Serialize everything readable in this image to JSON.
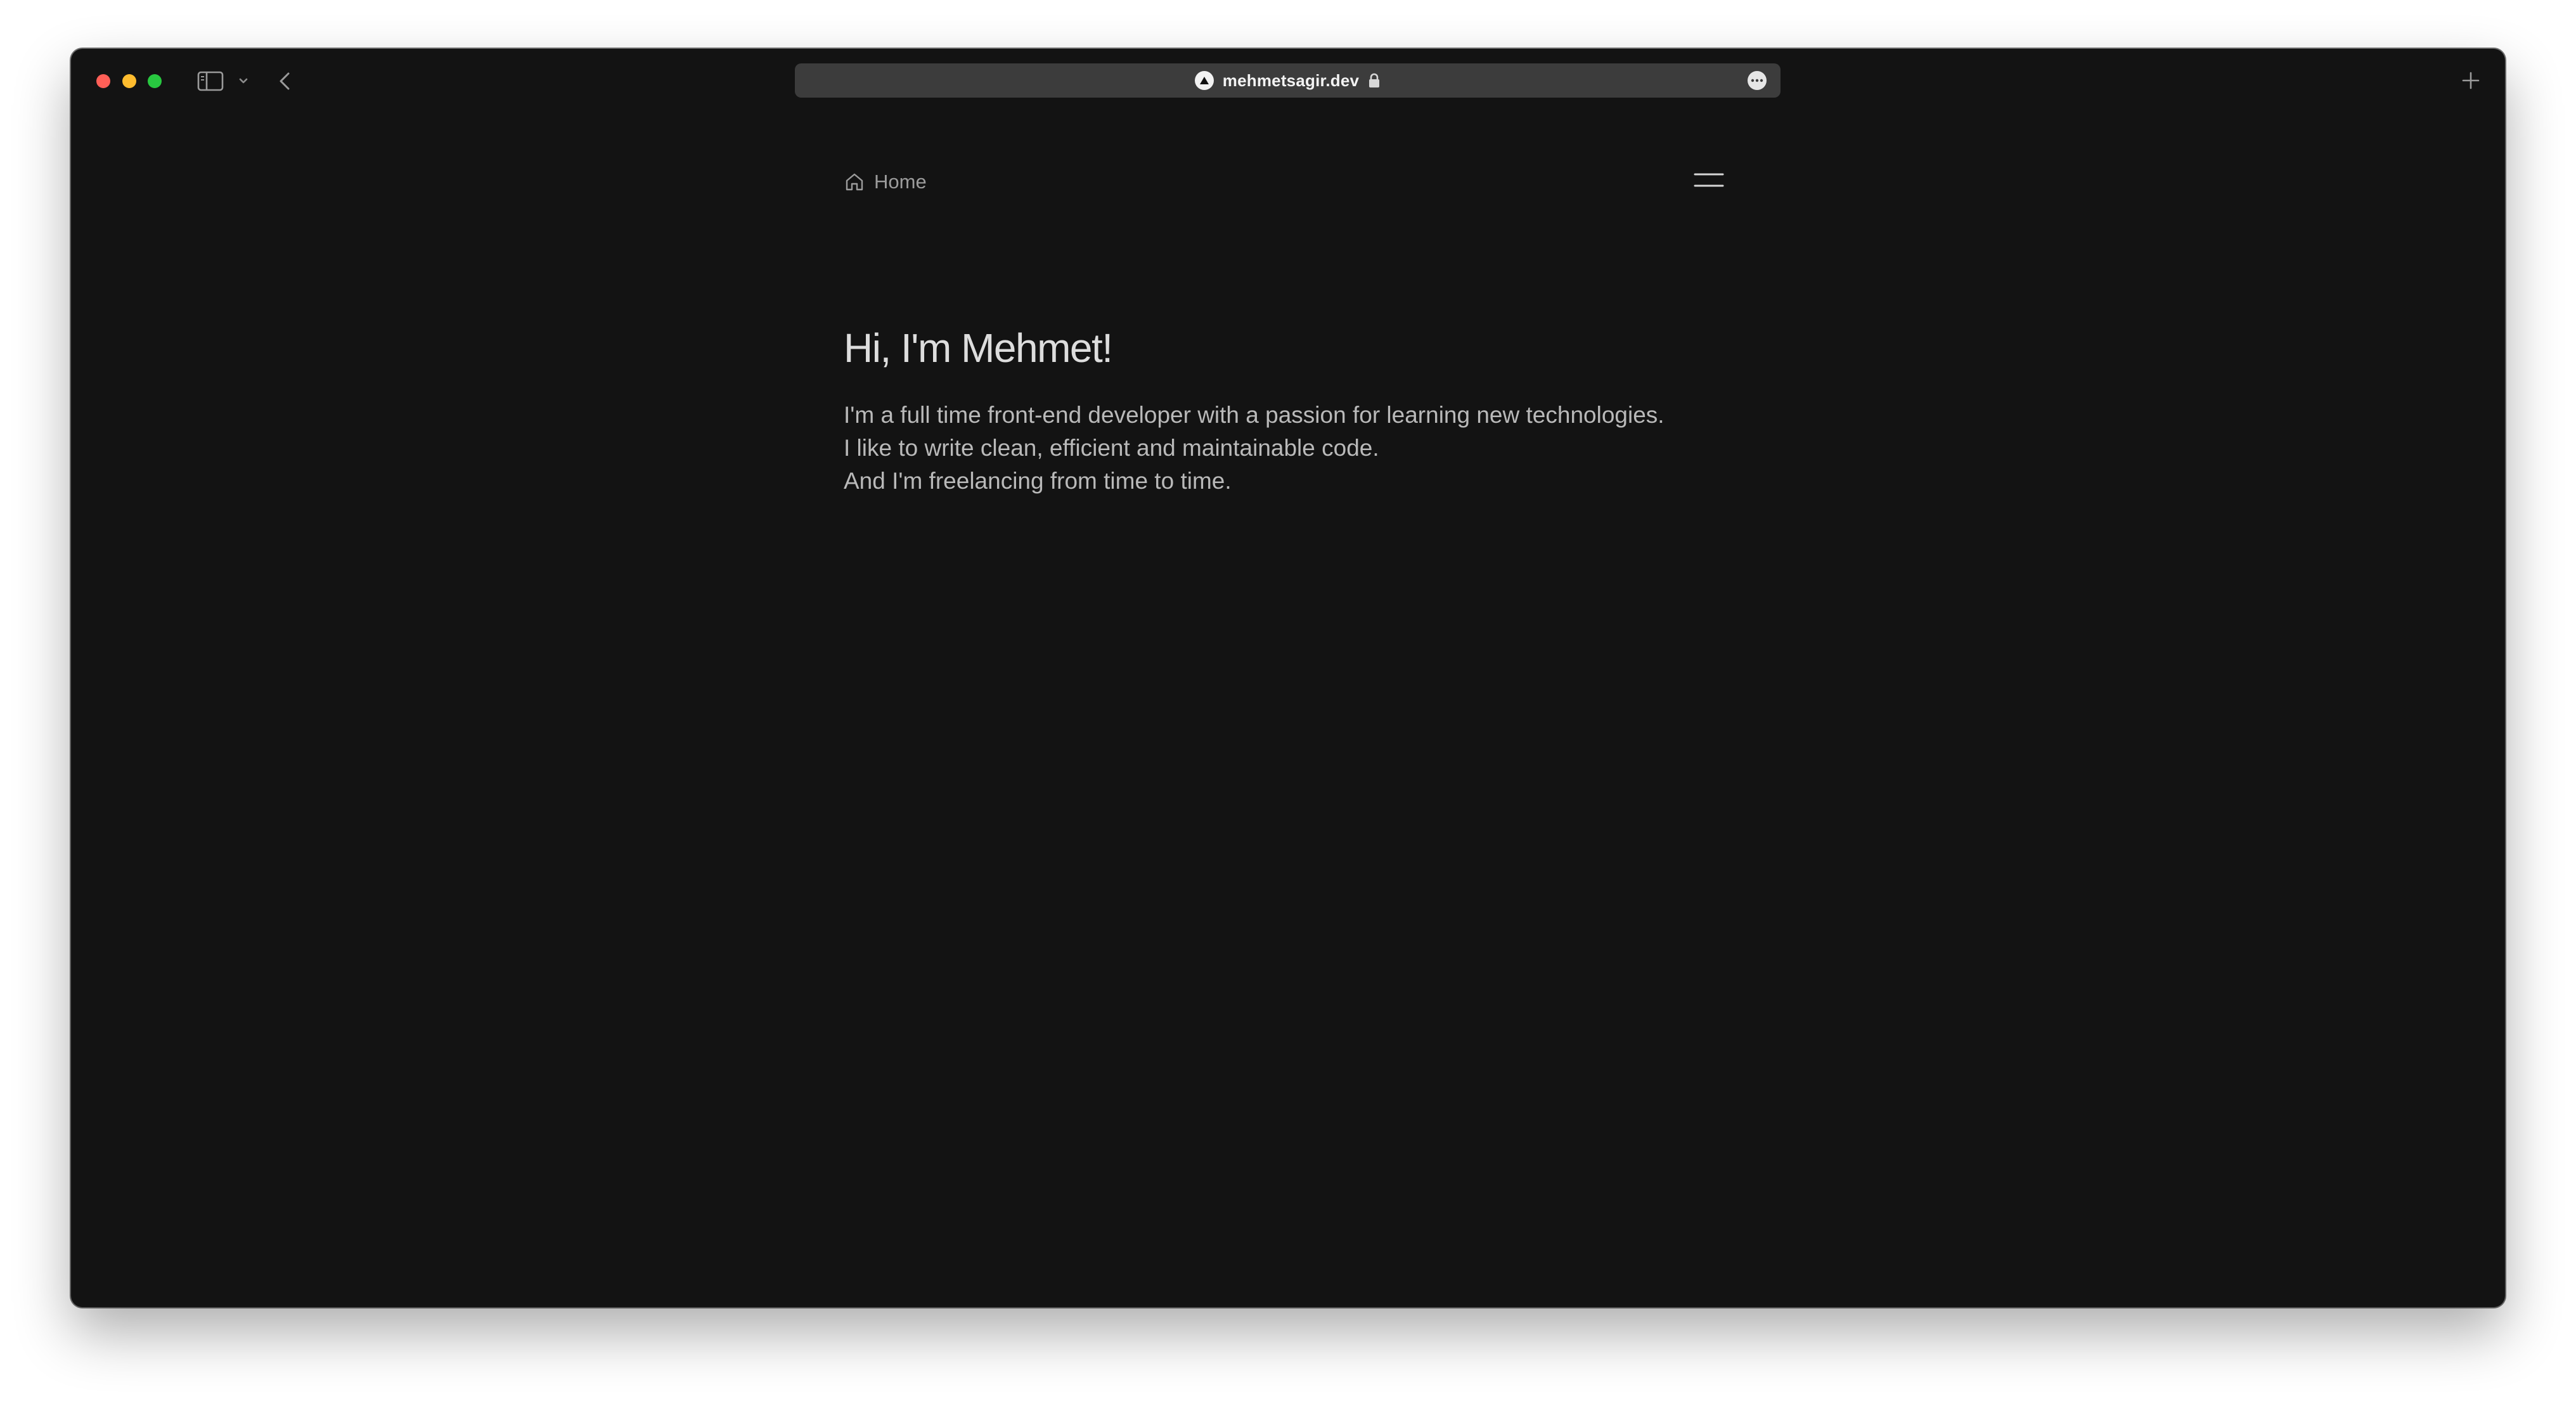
{
  "browser": {
    "url": "mehmetsagir.dev",
    "icons": {
      "sidebar": "sidebar-icon",
      "chevron": "chevron-down-icon",
      "back": "back-arrow-icon",
      "lock": "lock-icon",
      "more": "more-icon",
      "new_tab": "plus-icon",
      "favicon": "triangle-logo-icon"
    },
    "colors": {
      "close": "#ff5f57",
      "minimize": "#febc2e",
      "maximize": "#28c840",
      "address_bar": "#3c3c3c",
      "page_background": "#131313"
    }
  },
  "nav": {
    "home_label": "Home",
    "home_icon": "home-icon",
    "menu_icon": "hamburger-menu-icon"
  },
  "hero": {
    "title": "Hi, I'm Mehmet!",
    "bio_lines": [
      "I'm a full time front-end developer with a passion for learning new technologies.",
      "I like to write clean, efficient and maintainable code.",
      "And I'm freelancing from time to time."
    ]
  }
}
